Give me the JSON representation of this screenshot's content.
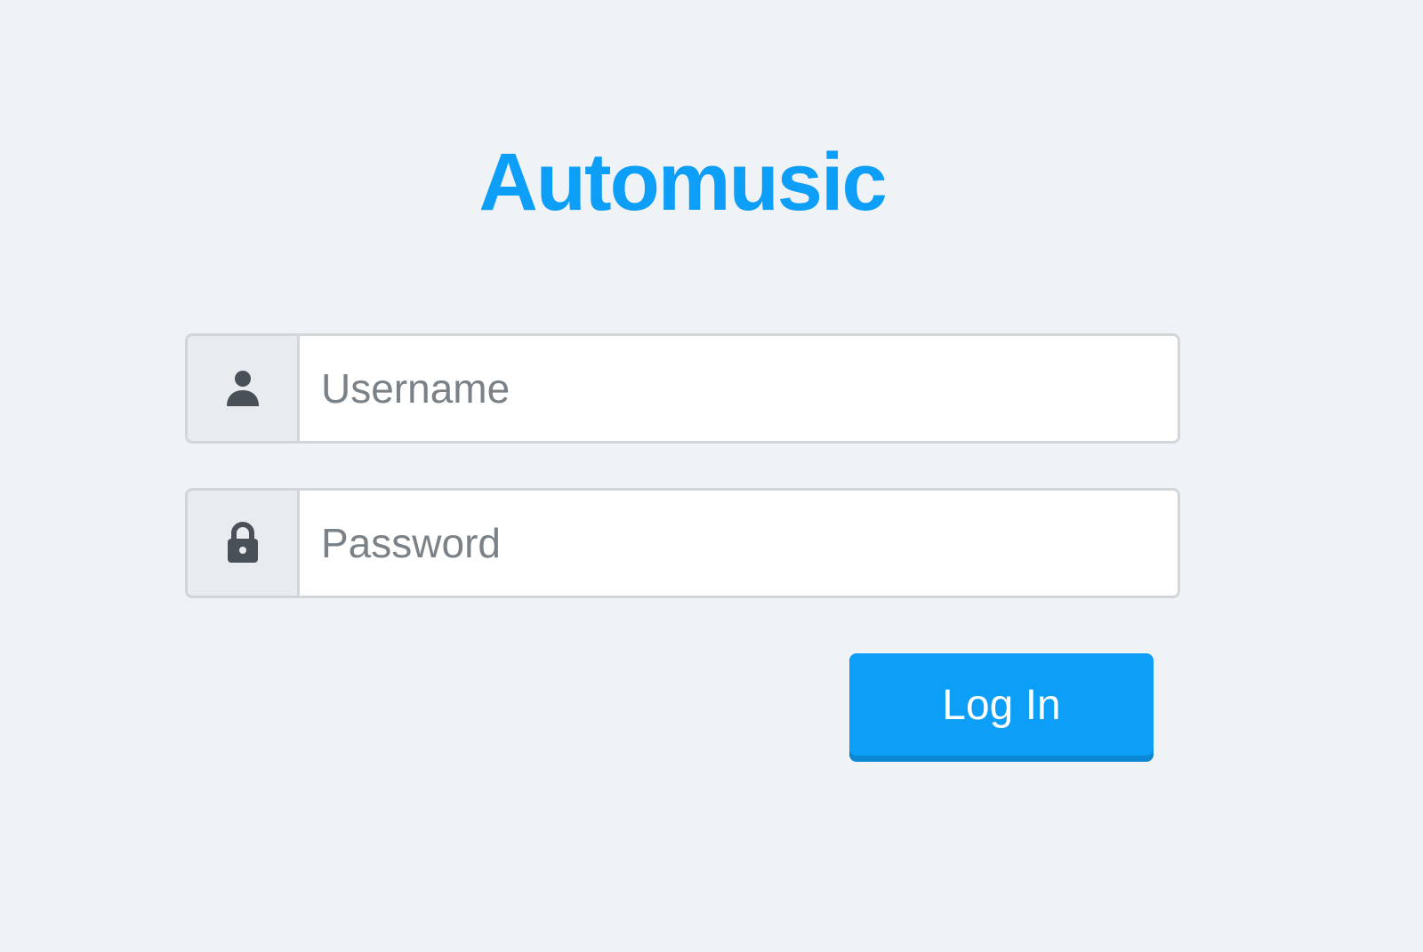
{
  "app": {
    "title": "Automusic"
  },
  "form": {
    "username": {
      "icon": "user-icon",
      "placeholder": "Username",
      "value": ""
    },
    "password": {
      "icon": "lock-icon",
      "placeholder": "Password",
      "value": ""
    },
    "submit_label": "Log In"
  },
  "colors": {
    "accent": "#0d9ef7",
    "background": "#f0f3f5",
    "icon": "#495057",
    "addon_background": "#e9ecef",
    "border": "#d3d6d9",
    "placeholder": "#7a8288"
  }
}
